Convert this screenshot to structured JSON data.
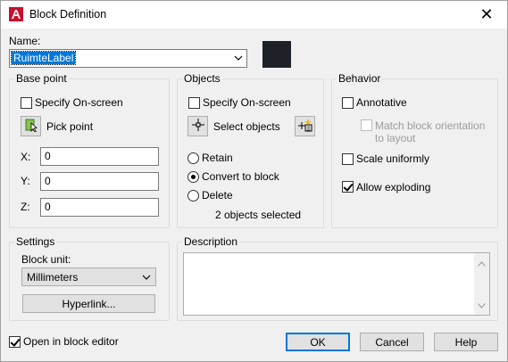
{
  "window": {
    "title": "Block Definition",
    "close_symbol": "✕"
  },
  "name": {
    "label": "Name:",
    "value": "RuimteLabel",
    "color_swatch": "#1e2228"
  },
  "base_point": {
    "title": "Base point",
    "specify_onscreen": "Specify On-screen",
    "pick_point": "Pick point",
    "x_label": "X:",
    "x_value": "0",
    "y_label": "Y:",
    "y_value": "0",
    "z_label": "Z:",
    "z_value": "0"
  },
  "objects": {
    "title": "Objects",
    "specify_onscreen": "Specify On-screen",
    "select_objects": "Select objects",
    "retain": "Retain",
    "convert": "Convert to block",
    "delete": "Delete",
    "selected_count": "2 objects selected"
  },
  "behavior": {
    "title": "Behavior",
    "annotative": "Annotative",
    "match_line1": "Match block orientation",
    "match_line2": "to layout",
    "scale_uniformly": "Scale uniformly",
    "allow_exploding": "Allow exploding"
  },
  "settings": {
    "title": "Settings",
    "block_unit_label": "Block unit:",
    "block_unit_value": "Millimeters",
    "hyperlink": "Hyperlink..."
  },
  "description": {
    "title": "Description",
    "value": ""
  },
  "footer": {
    "open_in_editor": "Open in block editor",
    "ok": "OK",
    "cancel": "Cancel",
    "help": "Help"
  },
  "colors": {
    "accent": "#0078d7",
    "autocad_red": "#c8102e"
  }
}
